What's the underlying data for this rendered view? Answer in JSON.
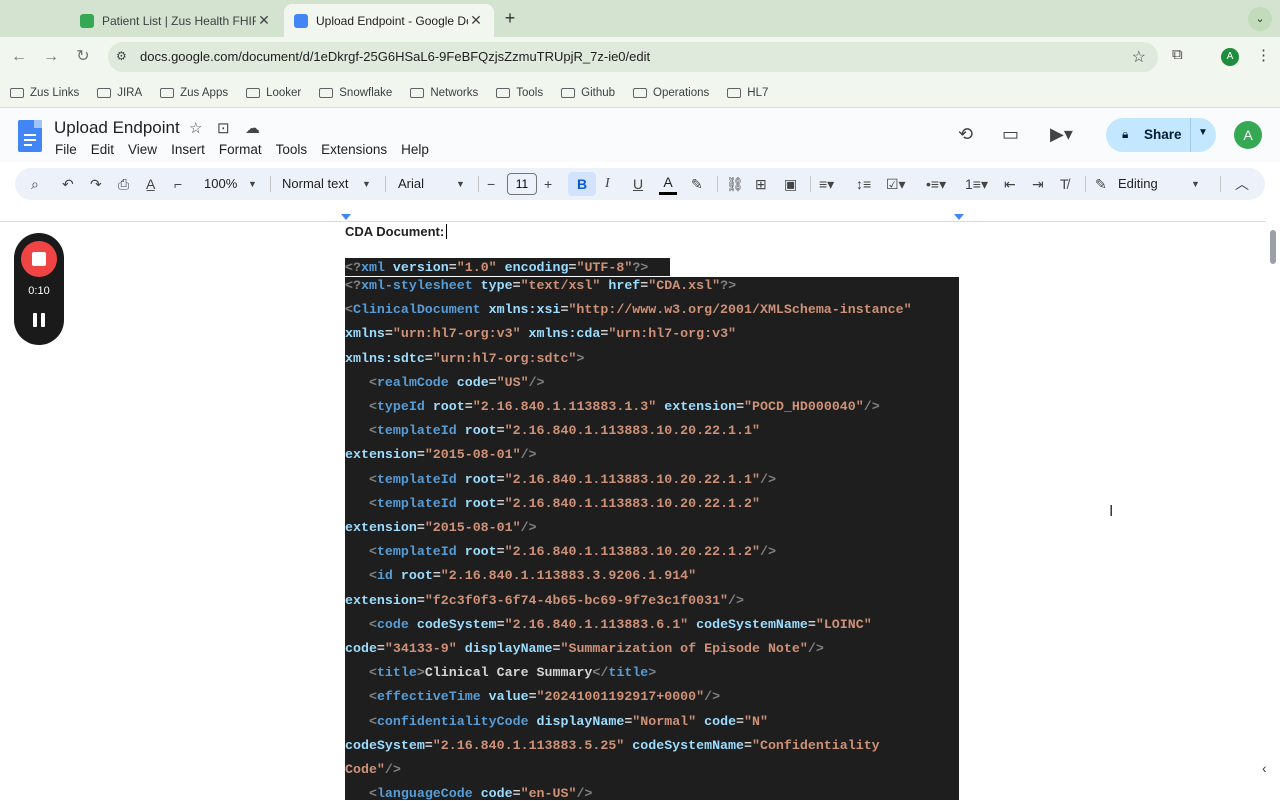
{
  "browser": {
    "tabs": [
      {
        "title": "Patient List | Zus Health FHIR",
        "favicon_color": "#34a853",
        "active": false
      },
      {
        "title": "Upload Endpoint - Google Do",
        "favicon_color": "#4285f4",
        "active": true
      }
    ],
    "url": "docs.google.com/document/d/1eDkrgf-25G6HSaL6-9FeBFQzjsZzmuTRUpjR_7z-ie0/edit",
    "profile_initial": "A",
    "bookmarks": [
      "Zus Links",
      "JIRA",
      "Zus Apps",
      "Looker",
      "Snowflake",
      "Networks",
      "Tools",
      "Github",
      "Operations",
      "HL7"
    ]
  },
  "docs": {
    "title": "Upload Endpoint",
    "menu": [
      "File",
      "Edit",
      "View",
      "Insert",
      "Format",
      "Tools",
      "Extensions",
      "Help"
    ],
    "share_label": "Share",
    "avatar_initial": "A",
    "accent": "#c2e7ff"
  },
  "toolbar": {
    "zoom": "100%",
    "style": "Normal text",
    "font": "Arial",
    "font_size": "11",
    "mode": "Editing"
  },
  "document": {
    "heading": "CDA Document:",
    "code_lines": [
      [
        [
          "p",
          "<?"
        ],
        [
          "t",
          "xml"
        ],
        [
          "x",
          " "
        ],
        [
          "a",
          "version"
        ],
        [
          "x",
          "="
        ],
        [
          "v",
          "\"1.0\""
        ],
        [
          "x",
          " "
        ],
        [
          "a",
          "encoding"
        ],
        [
          "x",
          "="
        ],
        [
          "v",
          "\"UTF-8\""
        ],
        [
          "p",
          "?>"
        ]
      ],
      [
        [
          "p",
          "<?"
        ],
        [
          "t",
          "xml-stylesheet"
        ],
        [
          "x",
          " "
        ],
        [
          "a",
          "type"
        ],
        [
          "x",
          "="
        ],
        [
          "v",
          "\"text/xsl\""
        ],
        [
          "x",
          " "
        ],
        [
          "a",
          "href"
        ],
        [
          "x",
          "="
        ],
        [
          "v",
          "\"CDA.xsl\""
        ],
        [
          "p",
          "?>"
        ]
      ],
      [
        [
          "p",
          "<"
        ],
        [
          "t",
          "ClinicalDocument"
        ],
        [
          "x",
          " "
        ],
        [
          "a",
          "xmlns:xsi"
        ],
        [
          "x",
          "="
        ],
        [
          "v",
          "\"http://www.w3.org/2001/XMLSchema-instance\""
        ]
      ],
      [
        [
          "a",
          "xmlns"
        ],
        [
          "x",
          "="
        ],
        [
          "v",
          "\"urn:hl7-org:v3\""
        ],
        [
          "x",
          " "
        ],
        [
          "a",
          "xmlns:cda"
        ],
        [
          "x",
          "="
        ],
        [
          "v",
          "\"urn:hl7-org:v3\""
        ]
      ],
      [
        [
          "a",
          "xmlns:sdtc"
        ],
        [
          "x",
          "="
        ],
        [
          "v",
          "\"urn:hl7-org:sdtc\""
        ],
        [
          "p",
          ">"
        ]
      ],
      [
        [
          "x",
          "   "
        ],
        [
          "p",
          "<"
        ],
        [
          "t",
          "realmCode"
        ],
        [
          "x",
          " "
        ],
        [
          "a",
          "code"
        ],
        [
          "x",
          "="
        ],
        [
          "v",
          "\"US\""
        ],
        [
          "p",
          "/>"
        ]
      ],
      [
        [
          "x",
          "   "
        ],
        [
          "p",
          "<"
        ],
        [
          "t",
          "typeId"
        ],
        [
          "x",
          " "
        ],
        [
          "a",
          "root"
        ],
        [
          "x",
          "="
        ],
        [
          "v",
          "\"2.16.840.1.113883.1.3\""
        ],
        [
          "x",
          " "
        ],
        [
          "a",
          "extension"
        ],
        [
          "x",
          "="
        ],
        [
          "v",
          "\"POCD_HD000040\""
        ],
        [
          "p",
          "/>"
        ]
      ],
      [
        [
          "x",
          "   "
        ],
        [
          "p",
          "<"
        ],
        [
          "t",
          "templateId"
        ],
        [
          "x",
          " "
        ],
        [
          "a",
          "root"
        ],
        [
          "x",
          "="
        ],
        [
          "v",
          "\"2.16.840.1.113883.10.20.22.1.1\""
        ]
      ],
      [
        [
          "a",
          "extension"
        ],
        [
          "x",
          "="
        ],
        [
          "v",
          "\"2015-08-01\""
        ],
        [
          "p",
          "/>"
        ]
      ],
      [
        [
          "x",
          "   "
        ],
        [
          "p",
          "<"
        ],
        [
          "t",
          "templateId"
        ],
        [
          "x",
          " "
        ],
        [
          "a",
          "root"
        ],
        [
          "x",
          "="
        ],
        [
          "v",
          "\"2.16.840.1.113883.10.20.22.1.1\""
        ],
        [
          "p",
          "/>"
        ]
      ],
      [
        [
          "x",
          "   "
        ],
        [
          "p",
          "<"
        ],
        [
          "t",
          "templateId"
        ],
        [
          "x",
          " "
        ],
        [
          "a",
          "root"
        ],
        [
          "x",
          "="
        ],
        [
          "v",
          "\"2.16.840.1.113883.10.20.22.1.2\""
        ]
      ],
      [
        [
          "a",
          "extension"
        ],
        [
          "x",
          "="
        ],
        [
          "v",
          "\"2015-08-01\""
        ],
        [
          "p",
          "/>"
        ]
      ],
      [
        [
          "x",
          "   "
        ],
        [
          "p",
          "<"
        ],
        [
          "t",
          "templateId"
        ],
        [
          "x",
          " "
        ],
        [
          "a",
          "root"
        ],
        [
          "x",
          "="
        ],
        [
          "v",
          "\"2.16.840.1.113883.10.20.22.1.2\""
        ],
        [
          "p",
          "/>"
        ]
      ],
      [
        [
          "x",
          "   "
        ],
        [
          "p",
          "<"
        ],
        [
          "t",
          "id"
        ],
        [
          "x",
          " "
        ],
        [
          "a",
          "root"
        ],
        [
          "x",
          "="
        ],
        [
          "v",
          "\"2.16.840.1.113883.3.9206.1.914\""
        ]
      ],
      [
        [
          "a",
          "extension"
        ],
        [
          "x",
          "="
        ],
        [
          "v",
          "\"f2c3f0f3-6f74-4b65-bc69-9f7e3c1f0031\""
        ],
        [
          "p",
          "/>"
        ]
      ],
      [
        [
          "x",
          "   "
        ],
        [
          "p",
          "<"
        ],
        [
          "t",
          "code"
        ],
        [
          "x",
          " "
        ],
        [
          "a",
          "codeSystem"
        ],
        [
          "x",
          "="
        ],
        [
          "v",
          "\"2.16.840.1.113883.6.1\""
        ],
        [
          "x",
          " "
        ],
        [
          "a",
          "codeSystemName"
        ],
        [
          "x",
          "="
        ],
        [
          "v",
          "\"LOINC\""
        ]
      ],
      [
        [
          "a",
          "code"
        ],
        [
          "x",
          "="
        ],
        [
          "v",
          "\"34133-9\""
        ],
        [
          "x",
          " "
        ],
        [
          "a",
          "displayName"
        ],
        [
          "x",
          "="
        ],
        [
          "v",
          "\"Summarization of Episode Note\""
        ],
        [
          "p",
          "/>"
        ]
      ],
      [
        [
          "x",
          "   "
        ],
        [
          "p",
          "<"
        ],
        [
          "t",
          "title"
        ],
        [
          "p",
          ">"
        ],
        [
          "x",
          "Clinical Care Summary"
        ],
        [
          "p",
          "</"
        ],
        [
          "t",
          "title"
        ],
        [
          "p",
          ">"
        ]
      ],
      [
        [
          "x",
          "   "
        ],
        [
          "p",
          "<"
        ],
        [
          "t",
          "effectiveTime"
        ],
        [
          "x",
          " "
        ],
        [
          "a",
          "value"
        ],
        [
          "x",
          "="
        ],
        [
          "v",
          "\"20241001192917+0000\""
        ],
        [
          "p",
          "/>"
        ]
      ],
      [
        [
          "x",
          "   "
        ],
        [
          "p",
          "<"
        ],
        [
          "t",
          "confidentialityCode"
        ],
        [
          "x",
          " "
        ],
        [
          "a",
          "displayName"
        ],
        [
          "x",
          "="
        ],
        [
          "v",
          "\"Normal\""
        ],
        [
          "x",
          " "
        ],
        [
          "a",
          "code"
        ],
        [
          "x",
          "="
        ],
        [
          "v",
          "\"N\""
        ]
      ],
      [
        [
          "a",
          "codeSystem"
        ],
        [
          "x",
          "="
        ],
        [
          "v",
          "\"2.16.840.1.113883.5.25\""
        ],
        [
          "x",
          " "
        ],
        [
          "a",
          "codeSystemName"
        ],
        [
          "x",
          "="
        ],
        [
          "v",
          "\"Confidentiality"
        ]
      ],
      [
        [
          "v",
          "Code\""
        ],
        [
          "p",
          "/>"
        ]
      ],
      [
        [
          "x",
          "   "
        ],
        [
          "p",
          "<"
        ],
        [
          "t",
          "languageCode"
        ],
        [
          "x",
          " "
        ],
        [
          "a",
          "code"
        ],
        [
          "x",
          "="
        ],
        [
          "v",
          "\"en-US\""
        ],
        [
          "p",
          "/>"
        ]
      ]
    ]
  },
  "recorder": {
    "time": "0:10",
    "stop_color": "#ef4444"
  }
}
